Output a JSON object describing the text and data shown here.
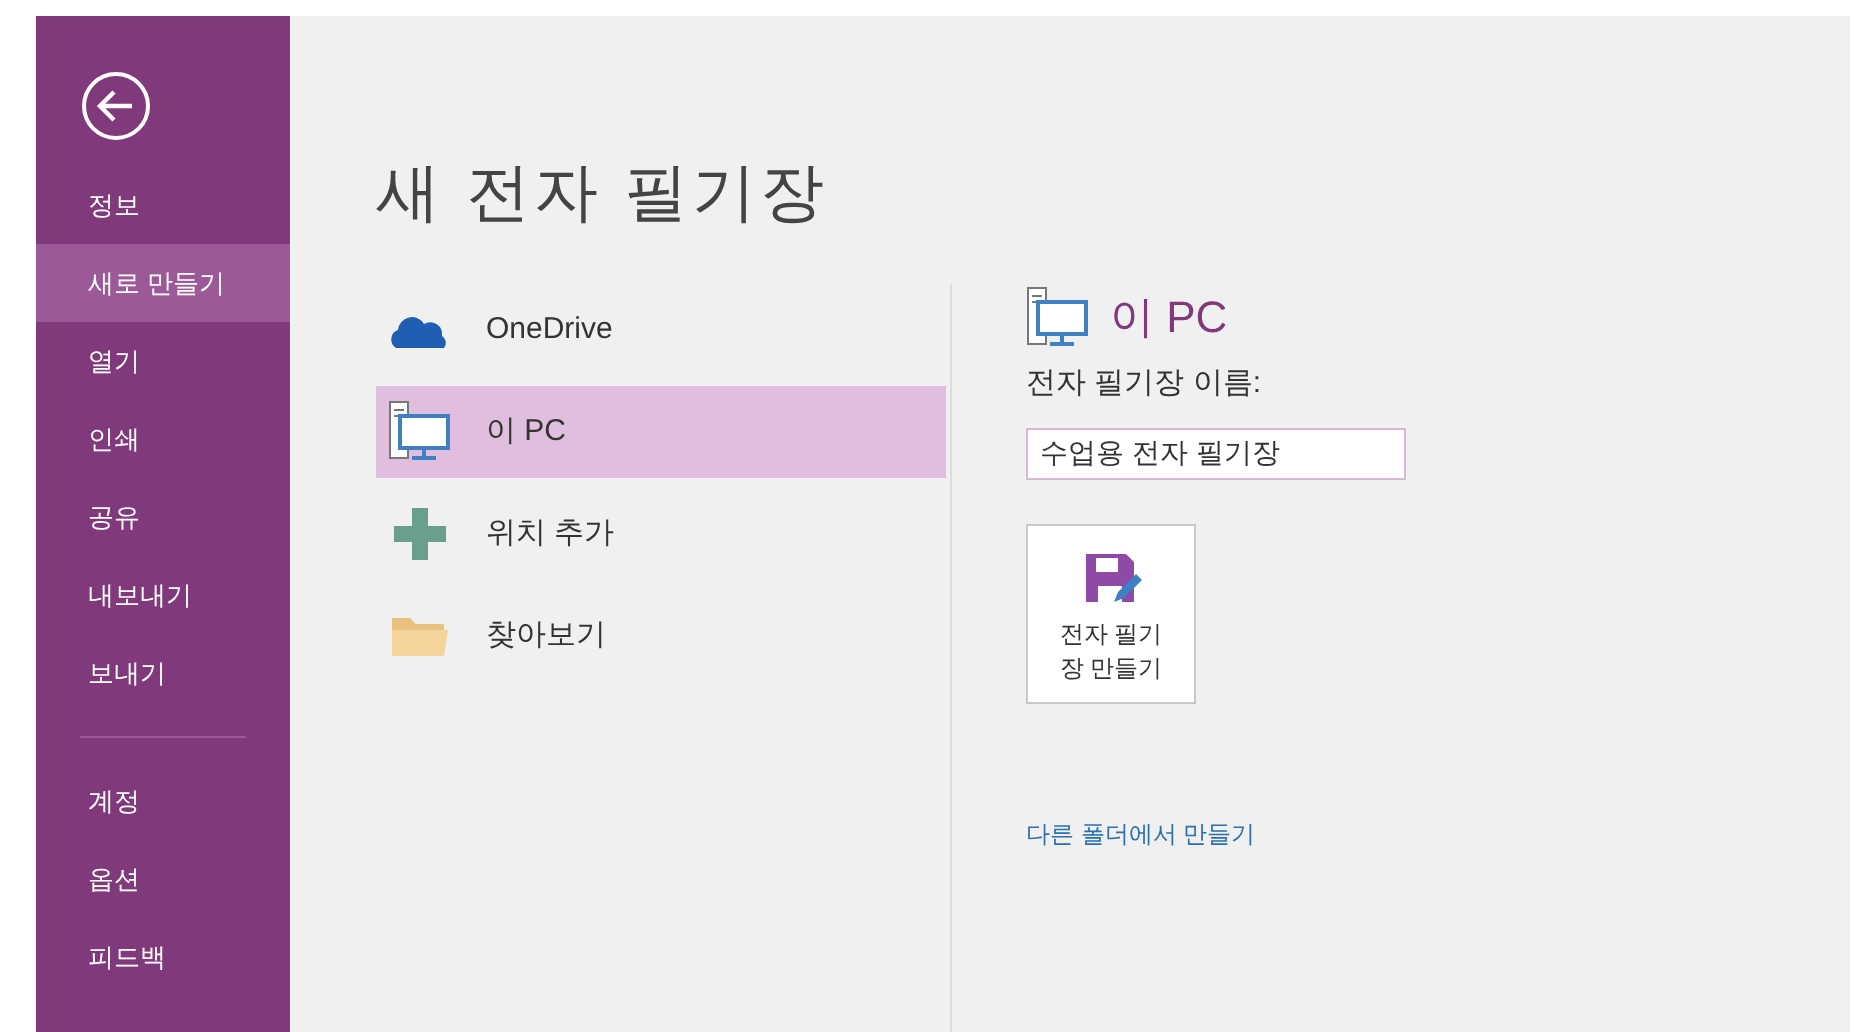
{
  "sidebar": {
    "items": [
      {
        "label": "정보",
        "selected": false
      },
      {
        "label": "새로 만들기",
        "selected": true
      },
      {
        "label": "열기",
        "selected": false
      },
      {
        "label": "인쇄",
        "selected": false
      },
      {
        "label": "공유",
        "selected": false
      },
      {
        "label": "내보내기",
        "selected": false
      },
      {
        "label": "보내기",
        "selected": false
      }
    ],
    "footer_items": [
      {
        "label": "계정",
        "selected": false
      },
      {
        "label": "옵션",
        "selected": false
      },
      {
        "label": "피드백",
        "selected": false
      }
    ]
  },
  "title": "새 전자 필기장",
  "locations": [
    {
      "kind": "cloud",
      "label": "OneDrive",
      "selected": false
    },
    {
      "kind": "pc",
      "label": "이 PC",
      "selected": true
    },
    {
      "kind": "add",
      "label": "위치 추가",
      "selected": false
    },
    {
      "kind": "folder",
      "label": "찾아보기",
      "selected": false
    }
  ],
  "detail": {
    "heading": "이 PC",
    "name_label": "전자 필기장 이름:",
    "name_value": "수업용 전자 필기장",
    "create_button": "전자 필기장 만들기",
    "link": "다른 폴더에서 만들기"
  }
}
